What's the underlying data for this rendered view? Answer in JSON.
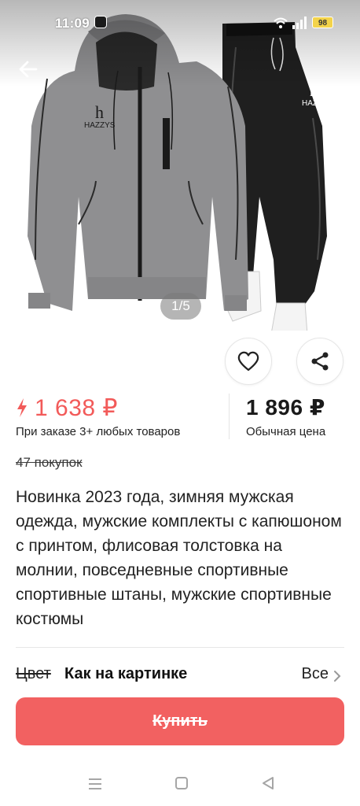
{
  "status": {
    "time": "11:09",
    "battery": "98"
  },
  "gallery": {
    "counter": "1/5",
    "brand_text": "HAZZYS"
  },
  "price": {
    "deal": "1 638 ₽",
    "deal_note": "При заказе 3+ любых товаров",
    "regular": "1 896 ₽",
    "regular_note": "Обычная цена"
  },
  "purchases": "47 покупок",
  "title": "Новинка 2023 года, зимняя мужская одежда, мужские комплекты с капюшоном с принтом, флисовая толстовка на молнии, повседневные спортивные спортивные штаны, мужские спортивные костюмы",
  "color": {
    "label": "Цвет",
    "value": "Как на картинке",
    "all": "Все"
  },
  "buy_label": "Купить",
  "colors": {
    "accent": "#f26161",
    "price_accent": "#f25a59"
  }
}
